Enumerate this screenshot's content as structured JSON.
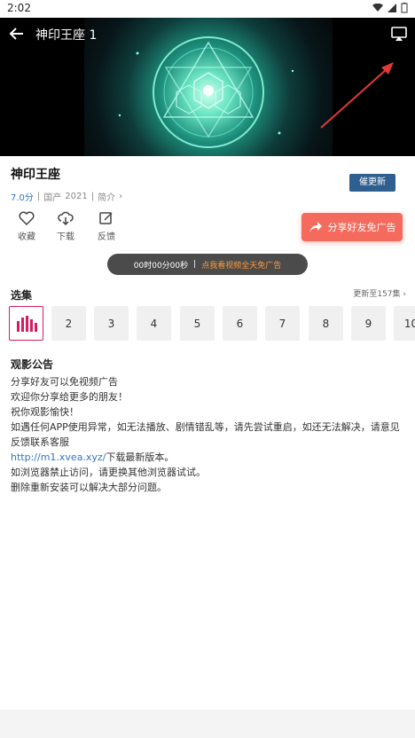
{
  "status": {
    "time": "2:02"
  },
  "video": {
    "title": "神印王座 1"
  },
  "show": {
    "title": "神印王座",
    "rating": "7.0分",
    "region": "国产",
    "year": "2021",
    "intro_link": "简介",
    "update_button": "催更新"
  },
  "actions": {
    "favorite": "收藏",
    "download": "下载",
    "feedback": "反馈"
  },
  "share_button": "分享好友免广告",
  "ad_banner": {
    "timer": "00时00分00秒",
    "separator": "|",
    "link": "点我看视频全天免广告"
  },
  "episodes": {
    "title": "选集",
    "more": "更新至157集",
    "items": [
      "2",
      "3",
      "4",
      "5",
      "6",
      "7",
      "8",
      "9",
      "10"
    ]
  },
  "notice": {
    "title": "观影公告",
    "line1": "分享好友可以免视频广告",
    "line2": "欢迎你分享给更多的朋友！",
    "line3": "祝你观影愉快！",
    "line4": "如遇任何APP使用异常，如无法播放、剧情错乱等，请先尝试重启，如还无法解决，请意见反馈联系客服",
    "url": "http://m1.xvea.xyz/",
    "line5_suffix": "下载最新版本。",
    "line6": "如浏览器禁止访问，请更换其他浏览器试试。",
    "line7": "删除重新安装可以解决大部分问题。"
  },
  "colors": {
    "accent_blue": "#2f5f8f",
    "share_red": "#f46a5c",
    "active_episode": "#d81b60",
    "ad_link": "#ff9a3c"
  }
}
